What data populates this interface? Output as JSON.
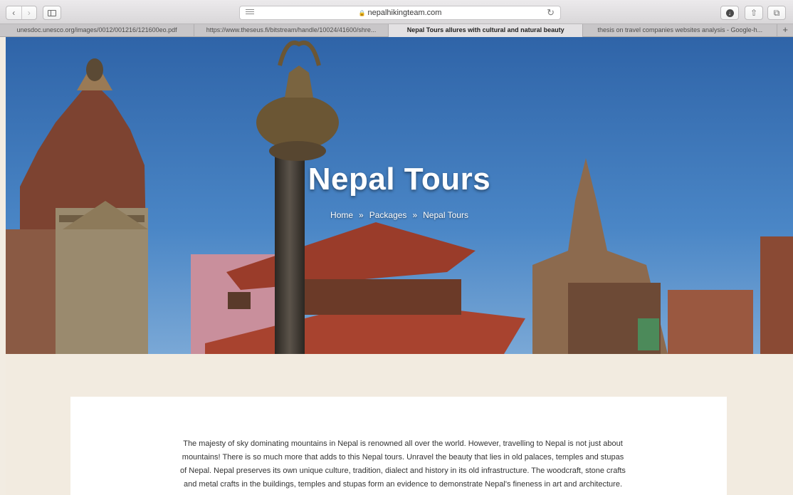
{
  "browser": {
    "url": "nepalhikingteam.com",
    "tabs": [
      {
        "title": "unesdoc.unesco.org/images/0012/001216/121600eo.pdf",
        "active": false
      },
      {
        "title": "https://www.theseus.fi/bitstream/handle/10024/41600/shre...",
        "active": false
      },
      {
        "title": "Nepal Tours allures with cultural and natural beauty",
        "active": true
      },
      {
        "title": "thesis on travel companies websites analysis - Google-h...",
        "active": false
      }
    ],
    "icons": {
      "back": "chevron-left-icon",
      "forward": "chevron-right-icon",
      "sidebar": "sidebar-icon",
      "reader": "reader-icon",
      "lock": "lock-icon",
      "reload": "reload-icon",
      "download": "download-icon",
      "share": "share-icon",
      "tabs": "tabs-overview-icon",
      "add_tab": "plus-icon"
    }
  },
  "hero": {
    "title": "Nepal Tours",
    "breadcrumb": {
      "home": "Home",
      "separator": "»",
      "packages": "Packages",
      "current": "Nepal Tours"
    }
  },
  "content": {
    "intro": "The majesty of sky dominating mountains in Nepal is renowned all over the world. However, travelling to Nepal is not just about mountains! There is so much more that adds to this Nepal tours. Unravel the beauty that lies in old palaces, temples and stupas of Nepal. Nepal preserves its own unique culture, tradition, dialect and history in its old infrastructure. The woodcraft, stone crafts and metal crafts in the buildings, temples and stupas form an evidence to demonstrate Nepal's fineness in art and architecture."
  },
  "colors": {
    "sky": "#3f7cc0",
    "brick": "#8a4a34",
    "roof": "#a8432f",
    "page_bg": "#f2ebe0"
  }
}
